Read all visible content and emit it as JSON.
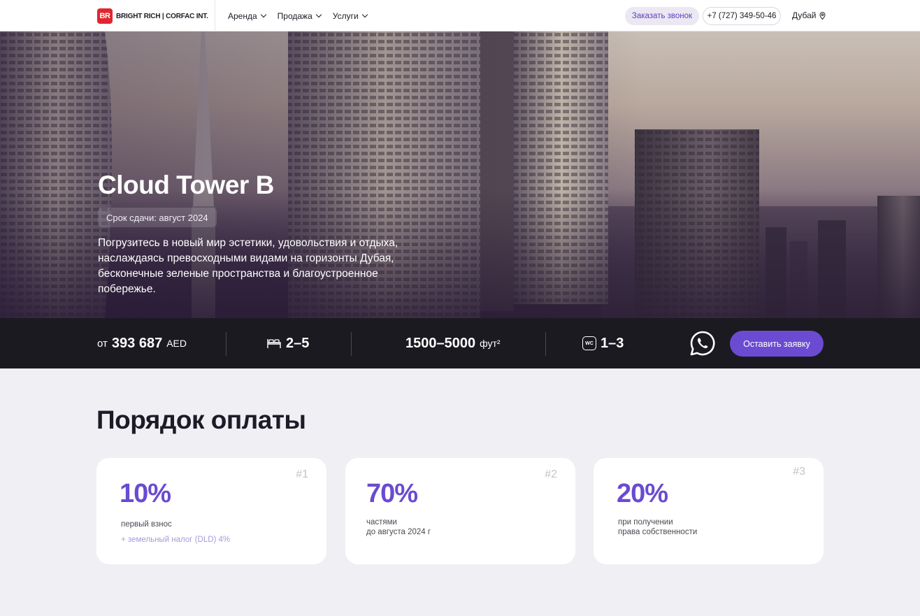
{
  "header": {
    "logo_mark": "BR",
    "logo_text": "BRIGHT RICH | CORFAC INT.",
    "nav": [
      {
        "label": "Аренда"
      },
      {
        "label": "Продажа"
      },
      {
        "label": "Услуги"
      }
    ],
    "callback_label": "Заказать звонок",
    "phone": "+7 (727) 349-50-46",
    "city": "Дубай"
  },
  "hero": {
    "title": "Cloud Tower B",
    "delivery": "Срок сдачи: август 2024",
    "description": "Погрузитесь в новый мир эстетики, удовольствия и отдыха, наслаждаясь превосходными видами на горизонты Дубая, бесконечные зеленые пространства и благоустроенное побережье."
  },
  "stats": {
    "price_prefix": "от",
    "price_value": "393 687",
    "price_unit": "AED",
    "bedrooms": "2–5",
    "area_value": "1500–5000",
    "area_unit": "фут²",
    "bathrooms_icon_text": "WC",
    "bathrooms": "1–3",
    "apply_label": "Оставить заявку"
  },
  "payment": {
    "title": "Порядок оплаты",
    "cards": [
      {
        "num": "#1",
        "percent": "10%",
        "line1": "первый взнос",
        "line2": "",
        "note": "+ земельный налог (DLD) 4%"
      },
      {
        "num": "#2",
        "percent": "70%",
        "line1": "частями",
        "line2": "до августа 2024 г",
        "note": ""
      },
      {
        "num": "#3",
        "percent": "20%",
        "line1": "при получении",
        "line2": "права собственности",
        "note": ""
      }
    ]
  },
  "colors": {
    "accent": "#6a4bd1",
    "brand_red": "#e0262f",
    "stats_bg": "#1b1a20",
    "page_bg": "#f0eff4"
  }
}
